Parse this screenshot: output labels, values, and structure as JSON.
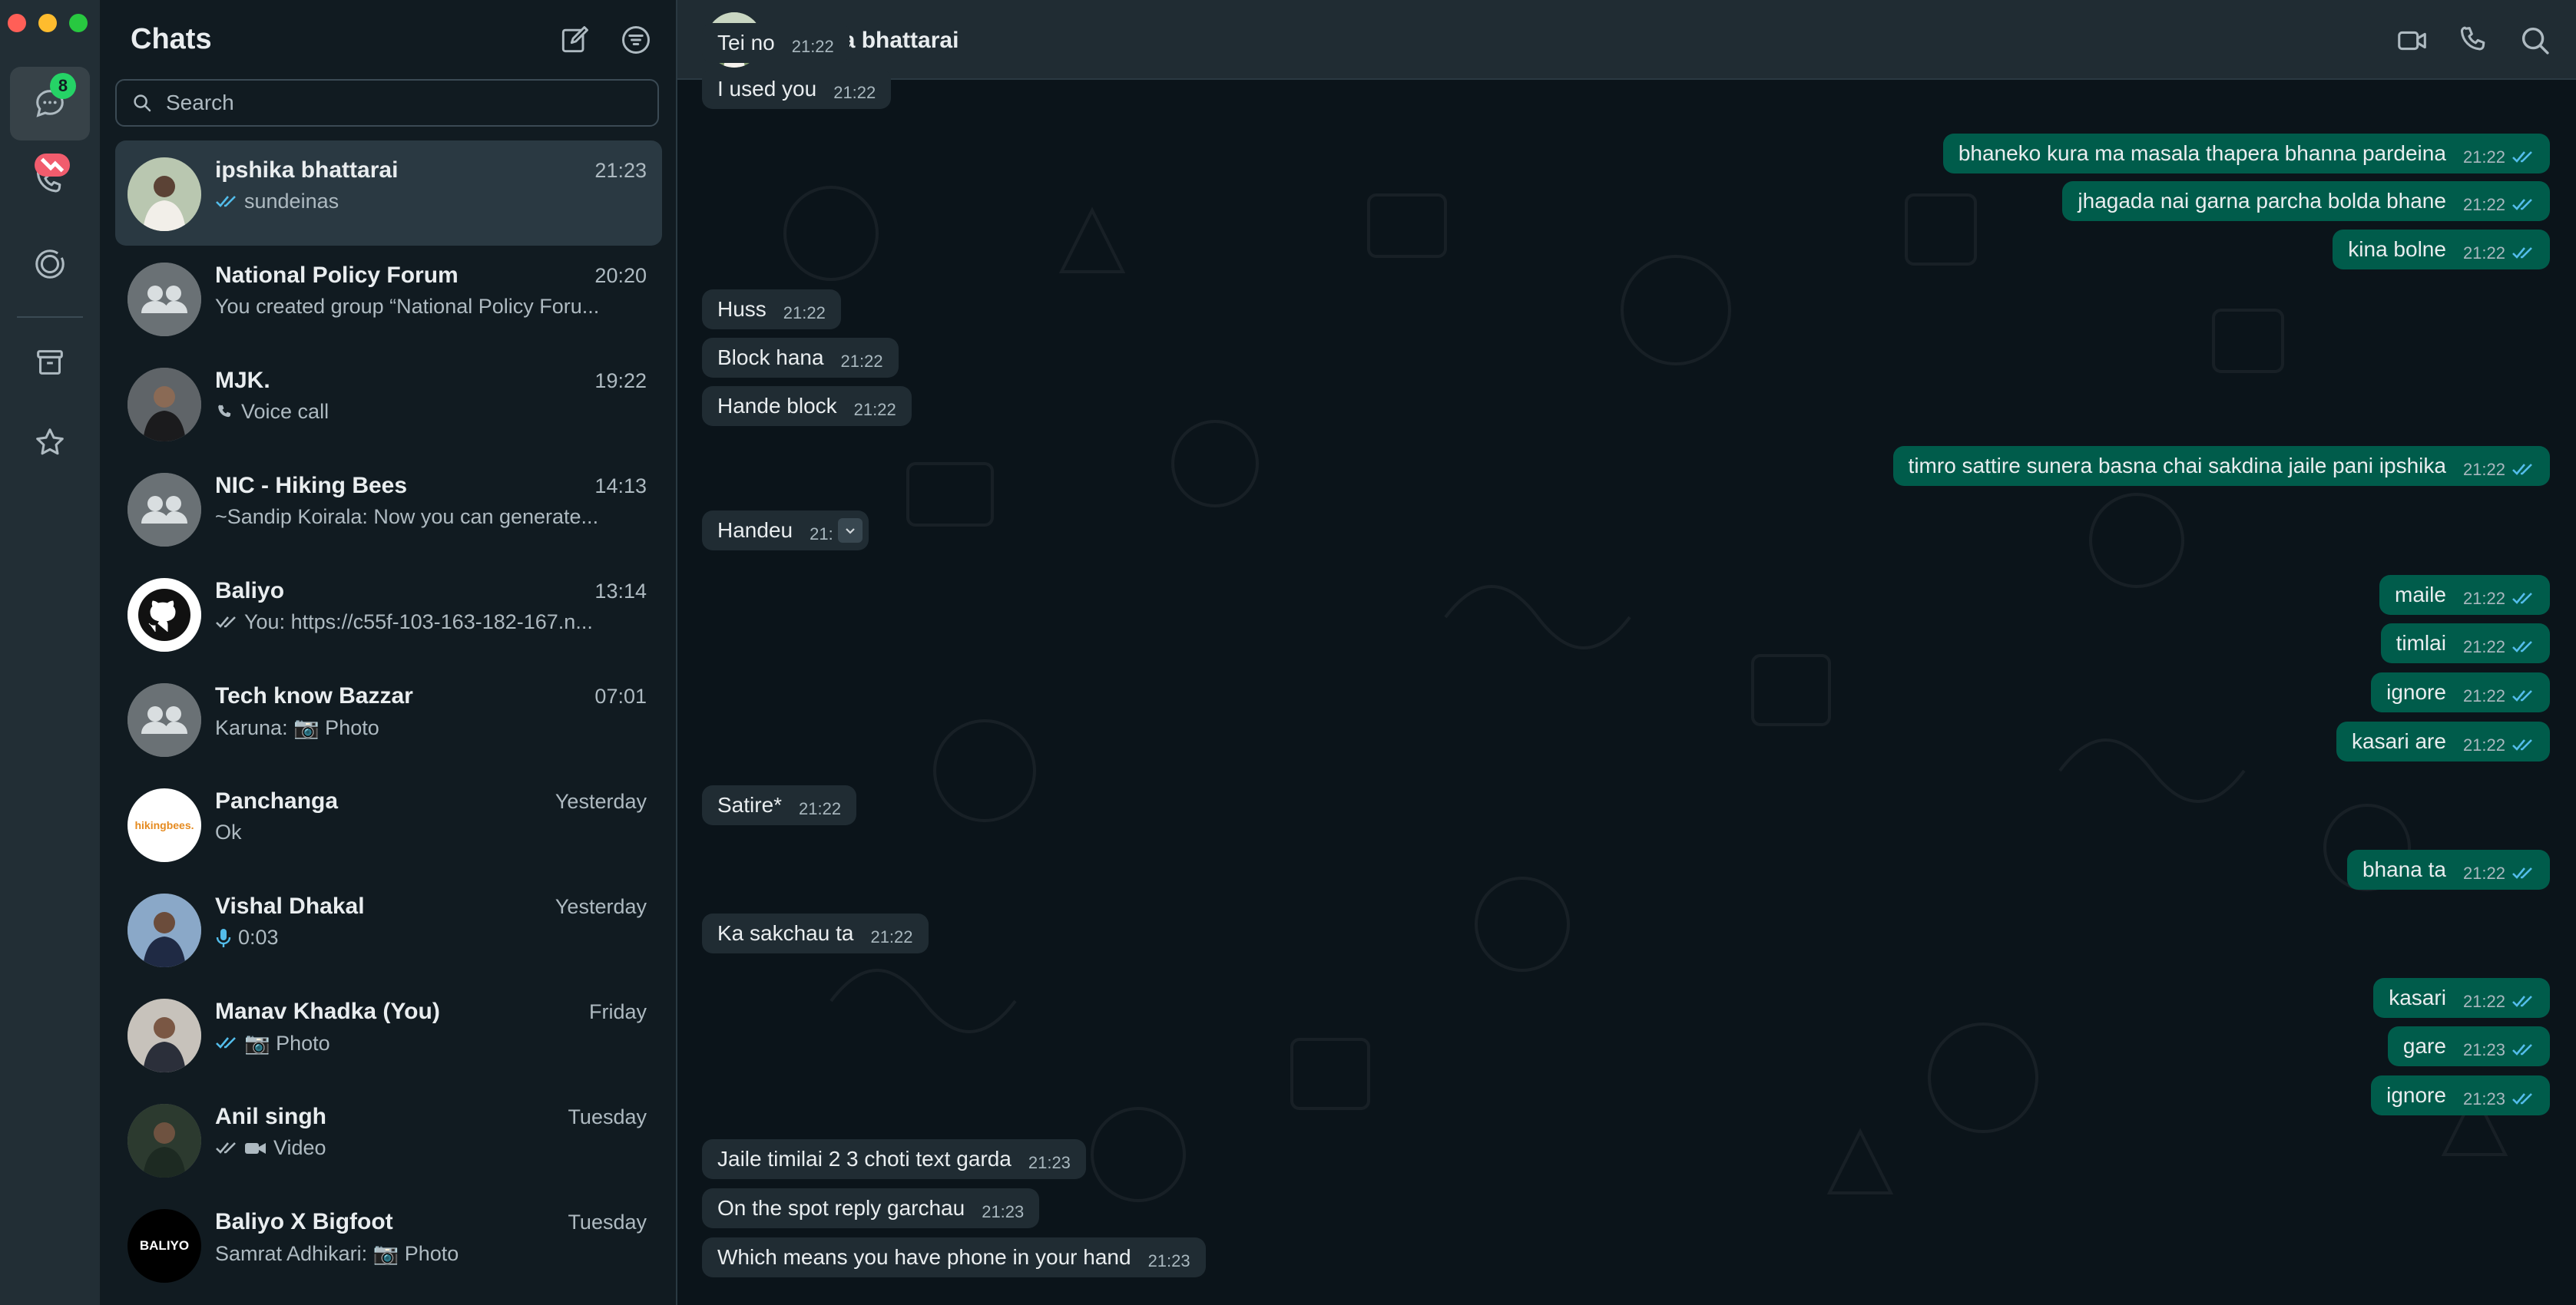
{
  "window": {
    "controls": [
      "close",
      "minimize",
      "zoom"
    ]
  },
  "rail": {
    "chats_badge": "8",
    "items": [
      {
        "name": "chats-icon"
      },
      {
        "name": "calls-icon"
      },
      {
        "name": "status-icon"
      },
      {
        "name": "archive-icon"
      },
      {
        "name": "starred-icon"
      }
    ]
  },
  "list": {
    "title": "Chats",
    "search_placeholder": "Search",
    "chats": [
      {
        "name": "ipshika bhattarai",
        "time": "21:23",
        "preview": "sundeinas",
        "status": "read"
      },
      {
        "name": "National Policy Forum",
        "time": "20:20",
        "preview": "You created group “National Policy Foru..."
      },
      {
        "name": "MJK.",
        "time": "19:22",
        "preview": "Voice call",
        "status": "call"
      },
      {
        "name": "NIC - Hiking Bees",
        "time": "14:13",
        "preview": "~Sandip Koirala: Now you can generate..."
      },
      {
        "name": "Baliyo",
        "time": "13:14",
        "preview": "You: https://c55f-103-163-182-167.n...",
        "status": "delivered"
      },
      {
        "name": "Tech know Bazzar",
        "time": "07:01",
        "preview": "Karuna: 📷 Photo"
      },
      {
        "name": "Panchanga",
        "time": "Yesterday",
        "preview": "Ok",
        "avatar_text": "hikingbees."
      },
      {
        "name": "Vishal Dhakal",
        "time": "Yesterday",
        "preview": "0:03",
        "status": "mic"
      },
      {
        "name": "Manav Khadka (You)",
        "time": "Friday",
        "preview": "📷 Photo",
        "status": "read"
      },
      {
        "name": "Anil singh",
        "time": "Tuesday",
        "preview": "Video",
        "status": "delivered-video"
      },
      {
        "name": "Baliyo X Bigfoot",
        "time": "Tuesday",
        "preview": "Samrat Adhikari: 📷 Photo",
        "avatar_text": "BALIYO"
      }
    ]
  },
  "conversation": {
    "contact_name": "ipshika bhattarai",
    "messages": [
      {
        "dir": "in",
        "text": "Tei no",
        "time": "21:22"
      },
      {
        "dir": "in",
        "text": "I used you",
        "time": "21:22"
      },
      {
        "dir": "out",
        "text": "bhaneko kura ma masala thapera bhanna pardeina",
        "time": "21:22"
      },
      {
        "dir": "out",
        "text": "jhagada nai garna parcha bolda bhane",
        "time": "21:22"
      },
      {
        "dir": "out",
        "text": "kina bolne",
        "time": "21:22"
      },
      {
        "dir": "in",
        "text": "Huss",
        "time": "21:22"
      },
      {
        "dir": "in",
        "text": "Block hana",
        "time": "21:22"
      },
      {
        "dir": "in",
        "text": "Hande block",
        "time": "21:22"
      },
      {
        "dir": "out",
        "text": "timro sattire sunera basna chai sakdina jaile pani ipshika",
        "time": "21:22"
      },
      {
        "dir": "in",
        "text": "Handeu",
        "time": "21:"
      },
      {
        "dir": "out",
        "text": "maile",
        "time": "21:22"
      },
      {
        "dir": "out",
        "text": "timlai",
        "time": "21:22"
      },
      {
        "dir": "out",
        "text": "ignore",
        "time": "21:22"
      },
      {
        "dir": "out",
        "text": "kasari are",
        "time": "21:22"
      },
      {
        "dir": "in",
        "text": "Satire*",
        "time": "21:22"
      },
      {
        "dir": "out",
        "text": "bhana ta",
        "time": "21:22"
      },
      {
        "dir": "in",
        "text": "Ka sakchau ta",
        "time": "21:22"
      },
      {
        "dir": "out",
        "text": "kasari",
        "time": "21:22"
      },
      {
        "dir": "out",
        "text": "gare",
        "time": "21:23"
      },
      {
        "dir": "out",
        "text": "ignore",
        "time": "21:23"
      },
      {
        "dir": "in",
        "text": "Jaile timilai 2 3 choti text garda",
        "time": "21:23"
      },
      {
        "dir": "in",
        "text": "On the spot reply garchau",
        "time": "21:23"
      },
      {
        "dir": "in",
        "text": "Which means you have phone in your hand",
        "time": "21:23"
      }
    ]
  },
  "colors": {
    "incoming_bubble": "#202c33",
    "outgoing_bubble": "#005c4b",
    "read_ticks": "#53bdeb",
    "badge_green": "#25d366",
    "badge_red": "#f15c6d"
  }
}
